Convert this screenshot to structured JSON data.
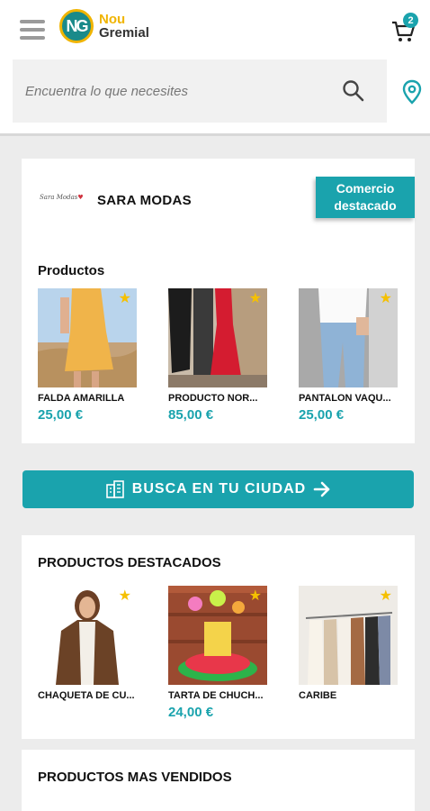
{
  "header": {
    "logo_mark": "NG",
    "logo_line1": "Nou",
    "logo_line2": "Gremial",
    "cart_count": "2"
  },
  "search": {
    "placeholder": "Encuentra lo que necesites"
  },
  "store": {
    "logo_text": "Sara Modas",
    "name": "SARA MODAS",
    "badge": "Comercio destacado",
    "section_title": "Productos",
    "products": [
      {
        "name": "FALDA AMARILLA",
        "price": "25,00 €"
      },
      {
        "name": "PRODUCTO NOR...",
        "price": "85,00 €"
      },
      {
        "name": "PANTALON VAQU...",
        "price": "25,00 €"
      }
    ]
  },
  "city_button": {
    "label": "BUSCA EN TU CIUDAD"
  },
  "featured": {
    "title": "PRODUCTOS DESTACADOS",
    "products": [
      {
        "name": "CHAQUETA DE CU...",
        "price": ""
      },
      {
        "name": "TARTA DE CHUCH...",
        "price": "24,00 €"
      },
      {
        "name": "CARIBE",
        "price": ""
      }
    ]
  },
  "bestsellers": {
    "title": "PRODUCTOS MAS VENDIDOS"
  },
  "colors": {
    "accent": "#1aa3ad",
    "star": "#f5c000",
    "logo_ring": "#f0b400"
  }
}
